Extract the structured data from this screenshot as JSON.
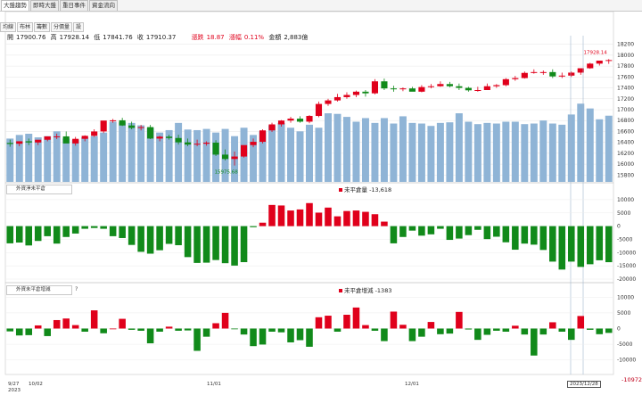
{
  "tabs": [
    "大盤趨勢",
    "即時大盤",
    "重日事件",
    "資金流向"
  ],
  "toolbar": [
    "均線",
    "布林",
    "籌數",
    "分價量",
    "設"
  ],
  "ohlc": {
    "open_label": "開",
    "open": "17900.76",
    "high_label": "高",
    "high": "17928.14",
    "low_label": "低",
    "low": "17841.76",
    "close_label": "收",
    "close": "17910.37",
    "change_label": "漲跌",
    "change": "18.87",
    "pct_label": "漲幅",
    "pct": "0.11%",
    "amount_label": "金額",
    "amount": "2,883億"
  },
  "panels": {
    "p1_select": "外資淨未平倉",
    "p1_legend_label": "未平倉量",
    "p1_legend_value": "-13,618",
    "p2_select": "外資未平倉增減",
    "p2_help": "?",
    "p2_legend_label": "未平倉增減",
    "p2_legend_value": "-1383"
  },
  "annotations": {
    "high_tag": "17928.14",
    "low_tag": "15975.68",
    "cursor_date": "2023/12/28",
    "p2_value_tag": "-10972"
  },
  "x_labels": {
    "start": "9/27",
    "d1": "10/02",
    "d2": "11/01",
    "d3": "12/01",
    "year": "2023"
  },
  "colors": {
    "up": "#e0001b",
    "down": "#118a1a",
    "volume": "#8fb4d6",
    "background": "#ffffff"
  },
  "chart_data": [
    {
      "type": "candlestick",
      "title": "",
      "yticks": [
        15800,
        16000,
        16200,
        16400,
        16600,
        16800,
        17000,
        17200,
        17400,
        17600,
        17800,
        18000,
        18200
      ],
      "ylim": [
        15740,
        18260
      ],
      "grid": true,
      "x_index": [
        0,
        1,
        2,
        3,
        4,
        5,
        6,
        7,
        8,
        9,
        10,
        11,
        12,
        13,
        14,
        15,
        16,
        17,
        18,
        19,
        20,
        21,
        22,
        23,
        24,
        25,
        26,
        27,
        28,
        29,
        30,
        31,
        32,
        33,
        34,
        35,
        36,
        37,
        38,
        39,
        40,
        41,
        42,
        43,
        44,
        45,
        46,
        47,
        48,
        49,
        50,
        51,
        52,
        53,
        54,
        55,
        56,
        57,
        58,
        59,
        60,
        61,
        62,
        63,
        64
      ],
      "open": [
        16390,
        16375,
        16420,
        16398,
        16448,
        16510,
        16510,
        16380,
        16465,
        16520,
        16600,
        16800,
        16805,
        16710,
        16665,
        16680,
        16470,
        16505,
        16480,
        16400,
        16360,
        16375,
        16395,
        16175,
        16095,
        16140,
        16350,
        16410,
        16620,
        16730,
        16800,
        16835,
        16780,
        16885,
        17105,
        17170,
        17230,
        17270,
        17330,
        17300,
        17520,
        17390,
        17375,
        17390,
        17330,
        17415,
        17430,
        17470,
        17430,
        17400,
        17355,
        17360,
        17430,
        17450,
        17560,
        17580,
        17675,
        17690,
        17690,
        17610,
        17625,
        17680,
        17760,
        17845,
        17900
      ],
      "high": [
        16450,
        16420,
        16470,
        16440,
        16510,
        16560,
        16600,
        16500,
        16530,
        16640,
        16700,
        16830,
        16850,
        16780,
        16720,
        16720,
        16520,
        16540,
        16540,
        16470,
        16450,
        16420,
        16440,
        16270,
        16230,
        16290,
        16470,
        16640,
        16760,
        16810,
        16870,
        16880,
        16900,
        17150,
        17200,
        17290,
        17320,
        17350,
        17360,
        17560,
        17570,
        17440,
        17410,
        17420,
        17450,
        17470,
        17520,
        17510,
        17480,
        17420,
        17420,
        17480,
        17470,
        17580,
        17620,
        17700,
        17740,
        17720,
        17740,
        17680,
        17700,
        17740,
        17860,
        17900,
        17928
      ],
      "low": [
        16320,
        16330,
        16350,
        16350,
        16420,
        16460,
        16390,
        16340,
        16420,
        16500,
        16570,
        16760,
        16700,
        16640,
        16620,
        16460,
        16420,
        16450,
        16360,
        16330,
        16330,
        16340,
        16150,
        16070,
        15975,
        16120,
        16310,
        16380,
        16590,
        16690,
        16760,
        16760,
        16750,
        16860,
        17070,
        17150,
        17200,
        17230,
        17240,
        17280,
        17360,
        17330,
        17340,
        17340,
        17320,
        17390,
        17420,
        17410,
        17360,
        17330,
        17330,
        17360,
        17400,
        17430,
        17530,
        17570,
        17660,
        17640,
        17580,
        17580,
        17600,
        17640,
        17750,
        17810,
        17841
      ],
      "close": [
        16370,
        16420,
        16398,
        16448,
        16510,
        16510,
        16380,
        16465,
        16520,
        16600,
        16800,
        16805,
        16710,
        16665,
        16680,
        16470,
        16505,
        16480,
        16400,
        16360,
        16375,
        16395,
        16175,
        16095,
        16140,
        16350,
        16410,
        16620,
        16730,
        16800,
        16835,
        16780,
        16885,
        17105,
        17170,
        17230,
        17270,
        17330,
        17300,
        17520,
        17390,
        17375,
        17390,
        17330,
        17415,
        17430,
        17470,
        17430,
        17400,
        17355,
        17360,
        17430,
        17450,
        17560,
        17580,
        17675,
        17690,
        17690,
        17610,
        17625,
        17680,
        17760,
        17845,
        17900,
        17910
      ],
      "volume": [
        3600,
        3900,
        4000,
        3700,
        3800,
        4200,
        3600,
        3500,
        3700,
        3800,
        4100,
        5000,
        4950,
        4900,
        4700,
        4500,
        4100,
        4300,
        4900,
        4350,
        4300,
        4400,
        4100,
        4400,
        3800,
        4500,
        3900,
        4200,
        4700,
        4900,
        4500,
        4200,
        4750,
        4500,
        5700,
        5650,
        5400,
        5000,
        5300,
        4900,
        5300,
        4850,
        5450,
        4900,
        4850,
        4650,
        4900,
        4950,
        5700,
        5000,
        4800,
        4900,
        4850,
        5000,
        5000,
        4800,
        4850,
        5100,
        4850,
        4750,
        5600,
        6500,
        6100,
        5200,
        5500
      ],
      "max_volume": 8000
    },
    {
      "type": "bar",
      "title": "外資淨未平倉",
      "series": [
        {
          "name": "未平倉量",
          "values": [
            -6500,
            -6200,
            -7300,
            -5600,
            -3800,
            -6600,
            -4100,
            -2800,
            -1000,
            -700,
            -1000,
            -3800,
            -4500,
            -7100,
            -9700,
            -10400,
            -9100,
            -6700,
            -7200,
            -11700,
            -13900,
            -13800,
            -12800,
            -14000,
            -14900,
            -13600,
            -400,
            1300,
            8000,
            7800,
            5900,
            6300,
            8700,
            5100,
            7000,
            3700,
            5700,
            5900,
            5400,
            4500,
            1700,
            -6500,
            -4100,
            -1700,
            -3600,
            -3100,
            -1000,
            -5200,
            -4700,
            -3400,
            -1400,
            -4900,
            -4000,
            -6100,
            -8900,
            -6600,
            -7000,
            -9000,
            -13400,
            -16400,
            -13400,
            -15400,
            -14400,
            -12900,
            -13618
          ]
        }
      ],
      "yticks": [
        -20000,
        -15000,
        -10000,
        -5000,
        0,
        5000,
        10000
      ],
      "ylim": [
        -20000,
        13000
      ],
      "grid": true
    },
    {
      "type": "bar",
      "title": "外資未平倉增減",
      "series": [
        {
          "name": "未平倉增減",
          "values": [
            -900,
            -2200,
            -2100,
            1000,
            -2400,
            2700,
            3200,
            1100,
            -1000,
            5800,
            -1500,
            0,
            3100,
            -400,
            -700,
            -4700,
            -1000,
            600,
            -700,
            -600,
            -7100,
            -2600,
            1700,
            5000,
            -200,
            -1900,
            -5600,
            -5100,
            -1000,
            -1200,
            -4400,
            -3700,
            -5800,
            3600,
            4100,
            -1000,
            4400,
            6700,
            1100,
            -700,
            -4000,
            5400,
            1200,
            -4000,
            -2600,
            2100,
            -1800,
            -1600,
            5300,
            -300,
            -3600,
            -2000,
            -700,
            -1000,
            900,
            -1900,
            -8600,
            -1900,
            2000,
            -1000,
            -3600,
            4000,
            -400,
            -1800,
            -1383
          ]
        }
      ],
      "yticks": [
        -10000,
        -5000,
        0,
        5000,
        10000
      ],
      "ylim": [
        -13500,
        11500
      ],
      "grid": true
    }
  ]
}
